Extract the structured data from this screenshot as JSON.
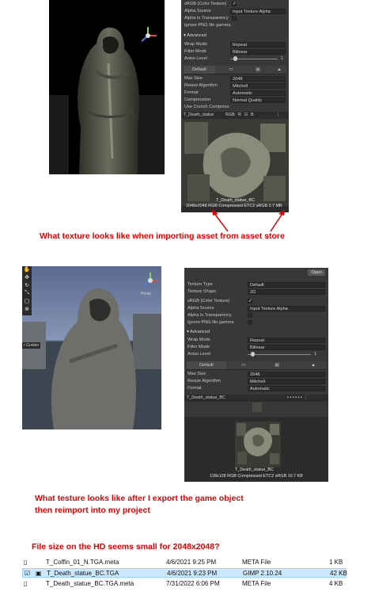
{
  "panel1": {
    "srgb_label": "sRGB (Color Texture)",
    "alpha_source_label": "Alpha Source",
    "alpha_source_value": "Input Texture Alpha",
    "alpha_transparency_label": "Alpha Is Transparency",
    "ignore_png_label": "Ignore PNG file gamma",
    "advanced_label": "Advanced",
    "wrap_mode_label": "Wrap Mode",
    "wrap_mode_value": "Repeat",
    "filter_mode_label": "Filter Mode",
    "filter_mode_value": "Bilinear",
    "aniso_label": "Aniso Level",
    "aniso_value": "1",
    "tab_default": "Default",
    "max_size_label": "Max Size",
    "max_size_value": "2048",
    "resize_label": "Resize Algorithm",
    "resize_value": "Mitchell",
    "format_label": "Format",
    "format_value": "Automatic",
    "compression_label": "Compression",
    "compression_value": "Normal Quality",
    "crunch_label": "Use Crunch Compress",
    "preview_name": "T_Death_statue",
    "channel_rgb": "RGB",
    "channel_r": "R",
    "channel_g": "G",
    "channel_b": "B",
    "texture_name_overlay": "T_Death_statue_BC",
    "texture_info": "2048x2048  RGB Compressed ETC2 sRGB  2.7 MB"
  },
  "caption1": "What texture looks like when importing asset from asset store",
  "scene2": {
    "persp_label": "Persp",
    "object_label": "r Golden"
  },
  "panel2": {
    "open_button": "Open",
    "texture_type_label": "Texture Type",
    "texture_type_value": "Default",
    "texture_shape_label": "Texture Shape",
    "texture_shape_value": "2D",
    "srgb_label": "sRGB (Color Texture)",
    "alpha_source_label": "Alpha Source",
    "alpha_source_value": "Input Texture Alpha",
    "alpha_transparency_label": "Alpha Is Transparency",
    "ignore_png_label": "Ignore PNG file gamma",
    "advanced_label": "Advanced",
    "wrap_mode_label": "Wrap Mode",
    "wrap_mode_value": "Repeat",
    "filter_mode_label": "Filter Mode",
    "filter_mode_value": "Bilinear",
    "aniso_label": "Aniso Level",
    "aniso_value": "1",
    "tab_default": "Default",
    "max_size_label": "Max Size",
    "max_size_value": "2048",
    "resize_label": "Resize Algorithm",
    "resize_value": "Mitchell",
    "format_label": "Format",
    "format_value": "Automatic",
    "preview_name": "T_Death_statue_BC",
    "texture_name_overlay": "T_Death_statue_BC",
    "texture_info": "128x128  RGB Compressed ETC2 sRGB  10.7 KB"
  },
  "caption2_line1": "What testure looks like after I export the game object",
  "caption2_line2": "then reimport into my project",
  "caption3": "File size on the HD seems small for 2048x2048?",
  "files": [
    {
      "name": "T_Coffin_01_N.TGA.meta",
      "date": "4/6/2021 9:25 PM",
      "type": "META File",
      "size": "1 KB",
      "selected": false
    },
    {
      "name": "T_Death_statue_BC.TGA",
      "date": "4/6/2021 9:23 PM",
      "type": "GIMP 2.10.24",
      "size": "42 KB",
      "selected": true
    },
    {
      "name": "T_Death_statue_BC.TGA.meta",
      "date": "7/31/2022 6:06 PM",
      "type": "META File",
      "size": "4 KB",
      "selected": false
    }
  ],
  "colors": {
    "accent_red": "#e60000",
    "inspector_bg": "#383838",
    "selection_bg": "#cce8ff"
  }
}
